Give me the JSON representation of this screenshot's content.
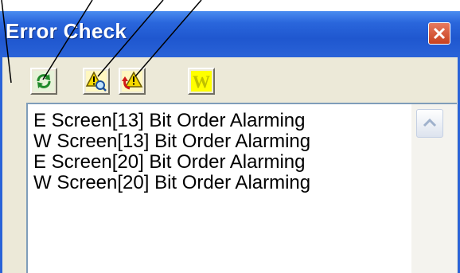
{
  "window": {
    "title": "Error Check",
    "close_icon": "close-x-icon"
  },
  "toolbar": {
    "buttons": [
      {
        "name": "refresh-button",
        "icon": "refresh-arrows-icon"
      },
      {
        "name": "find-alarm-button",
        "icon": "warning-magnifier-icon"
      },
      {
        "name": "jump-alarm-button",
        "icon": "warning-arrow-icon"
      },
      {
        "name": "warning-filter-button",
        "icon": "letter-w-icon",
        "glyph": "W"
      }
    ]
  },
  "errors": {
    "items": [
      "E Screen[13] Bit Order Alarming",
      "W Screen[13] Bit Order Alarming",
      "E Screen[20] Bit Order Alarming",
      "W Screen[20] Bit Order Alarming"
    ]
  },
  "colors": {
    "titlebar": "#2a63d8",
    "face": "#ece9d8",
    "close": "#d4502e",
    "w_icon_bg": "#ffff00",
    "w_icon_fg": "#c0c000"
  }
}
